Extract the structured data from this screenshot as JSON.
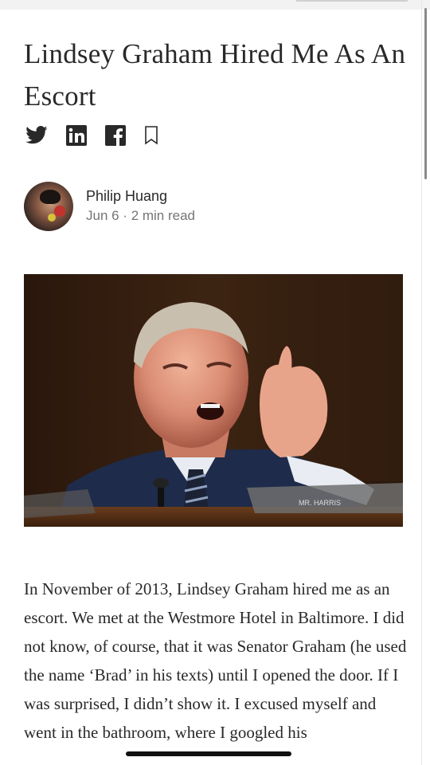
{
  "article": {
    "title": "Lindsey Graham Hired Me As An Escort",
    "author": {
      "name": "Philip Huang",
      "meta": "Jun 6 · 2 min read"
    },
    "body": "In November of 2013, Lindsey Graham hired me as an escort. We met at the Westmore Hotel in Baltimore. I did not know, of course, that it was Senator Graham (he used the name ‘Brad’ in his texts) until I opened the door. If I was surprised, I didn’t show it. I excused myself and went in the bathroom, where I googled his"
  },
  "share_icons": [
    "twitter-icon",
    "linkedin-icon",
    "facebook-icon",
    "bookmark-icon"
  ],
  "colors": {
    "text": "#292929",
    "meta": "#757575",
    "icon": "#292929"
  }
}
